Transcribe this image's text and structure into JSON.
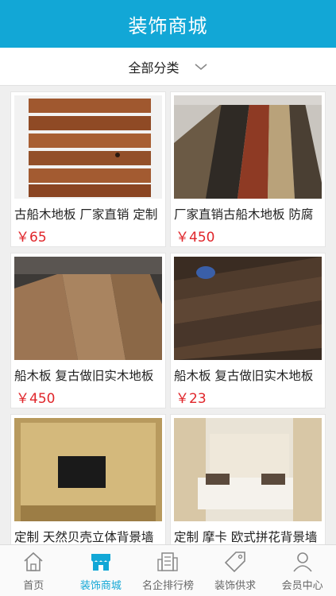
{
  "header": {
    "title": "装饰商城"
  },
  "filter": {
    "label": "全部分类",
    "icon": "chevron-down-icon"
  },
  "products": [
    {
      "name": "古船木地板 厂家直销 定制",
      "price": "￥65"
    },
    {
      "name": "厂家直销古船木地板 防腐",
      "price": "￥450"
    },
    {
      "name": "船木板 复古做旧实木地板",
      "price": "￥450"
    },
    {
      "name": "船木板 复古做旧实木地板",
      "price": "￥23"
    },
    {
      "name": "定制 天然贝壳立体背景墙",
      "price": ""
    },
    {
      "name": "定制 摩卡 欧式拼花背景墙",
      "price": ""
    }
  ],
  "tabs": [
    {
      "label": "首页",
      "icon": "home-icon"
    },
    {
      "label": "装饰商城",
      "icon": "store-icon"
    },
    {
      "label": "名企排行榜",
      "icon": "building-icon"
    },
    {
      "label": "装饰供求",
      "icon": "tag-icon"
    },
    {
      "label": "会员中心",
      "icon": "user-icon"
    }
  ],
  "colors": {
    "primary": "#12a7d6",
    "price": "#e0262b"
  }
}
